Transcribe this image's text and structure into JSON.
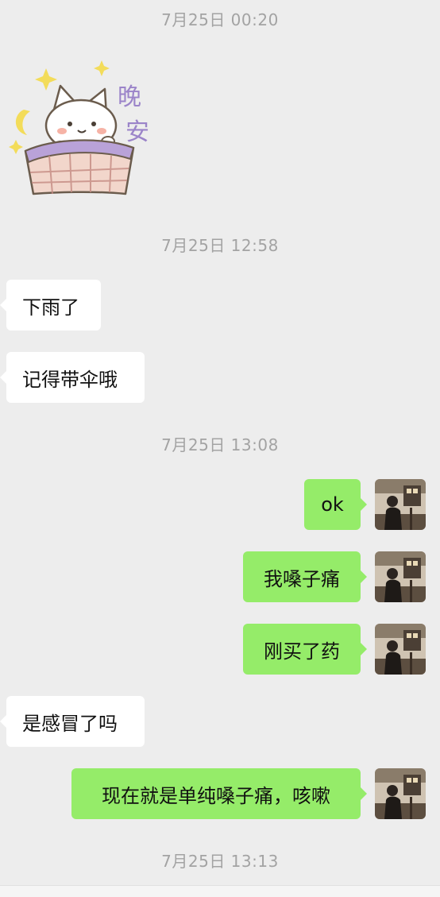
{
  "timestamps": {
    "t1": "7月25日 00:20",
    "t2": "7月25日 12:58",
    "t3": "7月25日 13:08",
    "t4": "7月25日 13:13"
  },
  "sticker": {
    "text": "晚安",
    "icon": "cat-goodnight-sticker"
  },
  "messages": [
    {
      "side": "left",
      "text": "下雨了"
    },
    {
      "side": "left",
      "text": "记得带伞哦"
    },
    {
      "side": "right",
      "text": "ok"
    },
    {
      "side": "right",
      "text": "我嗓子痛"
    },
    {
      "side": "right",
      "text": "刚买了药"
    },
    {
      "side": "left",
      "text": "是感冒了吗"
    },
    {
      "side": "right",
      "text": "现在就是单纯嗓子痛，咳嗽"
    }
  ],
  "colors": {
    "background": "#ededed",
    "bubble_self": "#95ec69",
    "bubble_other": "#ffffff",
    "timestamp": "#a3a3a3"
  }
}
